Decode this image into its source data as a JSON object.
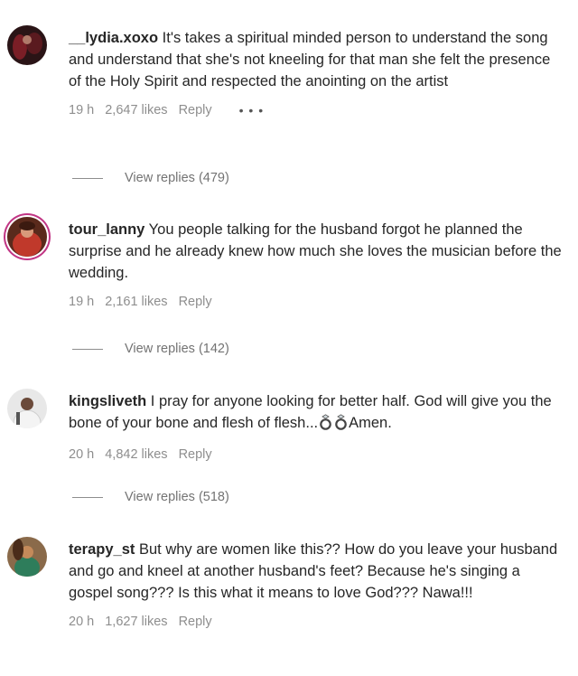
{
  "comments": [
    {
      "username": "__lydia.xoxo",
      "text": "It's takes a spiritual minded person to understand the song and understand that she's not kneeling for that man she felt the presence of the Holy Spirit and respected the anointing on the artist",
      "time": "19 h",
      "likes": "2,647 likes",
      "reply": "Reply",
      "more": "• • •",
      "view_replies": "View replies (479)"
    },
    {
      "username": "tour_lanny",
      "text": "You people talking for the husband forgot he planned the surprise and he already knew how much she loves the musician before the wedding.",
      "time": "19 h",
      "likes": "2,161 likes",
      "reply": "Reply",
      "view_replies": "View replies (142)"
    },
    {
      "username": "kingsliveth",
      "text": "I pray for anyone looking for better half. God will give you the bone of your bone and flesh of flesh...",
      "text_after": "Amen.",
      "time": "20 h",
      "likes": "4,842 likes",
      "reply": "Reply",
      "view_replies": "View replies (518)"
    },
    {
      "username": "terapy_st",
      "text": "But why are women like this?? How do you leave your husband and go and kneel at another husband's feet? Because he's singing a gospel song??? Is this what it means to love God??? Nawa!!!",
      "time": "20 h",
      "likes": "1,627 likes",
      "reply": "Reply"
    }
  ],
  "icons": {
    "emoji": "ring-icon",
    "more": "more-dots-icon"
  },
  "colors": {
    "story_ring": "#c13584",
    "meta": "#8e8e8e",
    "text": "#262626"
  }
}
